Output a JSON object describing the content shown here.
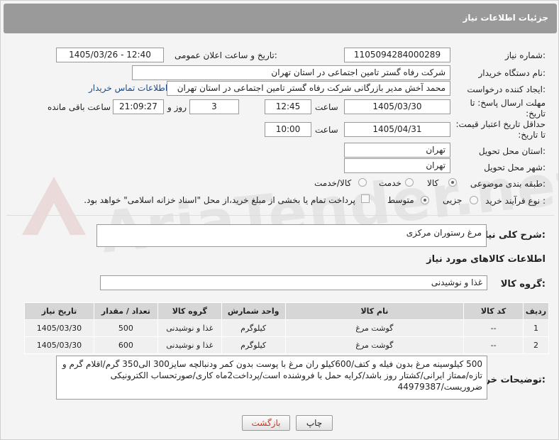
{
  "header": {
    "title": "جزئیات اطلاعات نیاز"
  },
  "fields": {
    "need_number_label": "شماره نیاز:",
    "need_number": "1105094284000289",
    "announce_label": "تاریخ و ساعت اعلان عمومی:",
    "announce_value": "1405/03/26 - 12:40",
    "buyer_org_label": "نام دستگاه خریدار:",
    "buyer_org": "شرکت رفاه گستر تامین اجتماعی در استان تهران",
    "creator_label": "ایجاد کننده درخواست:",
    "creator": "محمد آخش مدیر بازرگانی شرکت رفاه گستر تامین اجتماعی در استان تهران",
    "contact_link": "اطلاعات تماس خریدار",
    "deadline_label": "مهلت ارسال پاسخ: تا تاریخ:",
    "deadline_date": "1405/03/30",
    "time_word": "ساعت",
    "deadline_time": "12:45",
    "days_value": "3",
    "days_word": "روز و",
    "remaining_time": "21:09:27",
    "remaining_word": "ساعت باقی مانده",
    "validity_label": "حداقل تاریخ اعتبار قیمت: تا تاریخ:",
    "validity_date": "1405/04/31",
    "validity_time": "10:00",
    "province_label": "استان محل تحویل:",
    "province": "تهران",
    "city_label": "شهر محل تحویل:",
    "city": "تهران",
    "category_label": "طبقه بندی موضوعی:",
    "category_options": [
      "کالا",
      "خدمت",
      "کالا/خدمت"
    ],
    "process_label": "نوع فرآیند خرید :",
    "process_options": [
      "جزیی",
      "متوسط"
    ],
    "payment_note": "پرداخت تمام یا بخشی از مبلغ خرید،از محل \"اسناد خزانه اسلامی\" خواهد بود.",
    "summary_label": "شرح کلی نیاز:",
    "summary": "مرغ رستوران مرکزی",
    "goods_info_title": "اطلاعات کالاهای مورد نیاز",
    "goods_group_label": "گروه کالا:",
    "goods_group": "غذا و نوشیدنی"
  },
  "table": {
    "headers": [
      "ردیف",
      "کد کالا",
      "نام کالا",
      "واحد شمارش",
      "گروه کالا",
      "تعداد / مقدار",
      "تاریخ نیاز"
    ],
    "rows": [
      [
        "1",
        "--",
        "گوشت مرغ",
        "کیلوگرم",
        "غذا و نوشیدنی",
        "500",
        "1405/03/30"
      ],
      [
        "2",
        "--",
        "گوشت مرغ",
        "کیلوگرم",
        "غذا و نوشیدنی",
        "600",
        "1405/03/30"
      ]
    ]
  },
  "notes": {
    "label": "توضیحات خریدار:",
    "text": "500 کیلوسینه مرغ بدون فیله و کتف/600کیلو ران مرغ با پوست بدون کمر ودنبالچه سایز300 الی350 گرم/اقلام گرم و تازه/ممتاز ایرانی/کشتار روز باشد/کرایه حمل با فروشنده است/پرداخت2ماه کاری/صورتحساب الکترونیکی ضروریست/44979387"
  },
  "buttons": {
    "print": "چاپ",
    "back": "بازگشت"
  },
  "watermark": "AriaTender.net",
  "colors": {
    "header_bg": "#9a9a9a",
    "link": "#1a4a8a",
    "back_text": "#c0392b"
  }
}
